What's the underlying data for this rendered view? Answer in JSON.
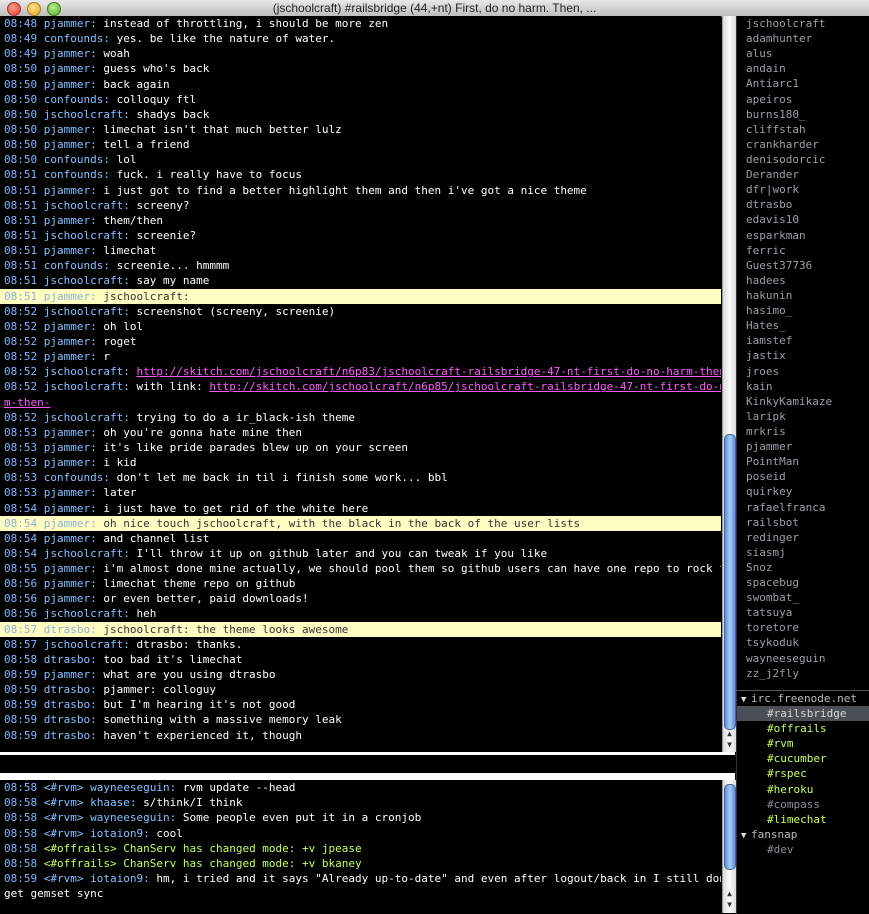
{
  "window": {
    "title": "(jschoolcraft) #railsbridge (44,+nt) First, do no harm. Then, ..."
  },
  "chat": [
    {
      "ts": "08:48",
      "nick": "pjammer:",
      "text": " instead of throttling, i should be more zen"
    },
    {
      "ts": "08:49",
      "nick": "confounds:",
      "text": " yes. be like the nature of water."
    },
    {
      "ts": "08:49",
      "nick": "pjammer:",
      "text": " woah"
    },
    {
      "ts": "08:50",
      "nick": "pjammer:",
      "text": " guess who's back"
    },
    {
      "ts": "08:50",
      "nick": "pjammer:",
      "text": " back again"
    },
    {
      "ts": "08:50",
      "nick": "confounds:",
      "text": " colloquy ftl"
    },
    {
      "ts": "08:50",
      "nick": "jschoolcraft:",
      "text": " shadys back"
    },
    {
      "ts": "08:50",
      "nick": "pjammer:",
      "text": " limechat isn't that much better lulz"
    },
    {
      "ts": "08:50",
      "nick": "pjammer:",
      "text": " tell a friend"
    },
    {
      "ts": "08:50",
      "nick": "confounds:",
      "text": " lol"
    },
    {
      "ts": "08:51",
      "nick": "confounds:",
      "text": " fuck. i really have to focus"
    },
    {
      "ts": "08:51",
      "nick": "pjammer:",
      "text": " i just got to find a better highlight them and then i've got a nice theme"
    },
    {
      "ts": "08:51",
      "nick": "jschoolcraft:",
      "text": " screeny?"
    },
    {
      "ts": "08:51",
      "nick": "pjammer:",
      "text": " them/then"
    },
    {
      "ts": "08:51",
      "nick": "jschoolcraft:",
      "text": " screenie?"
    },
    {
      "ts": "08:51",
      "nick": "pjammer:",
      "text": " limechat"
    },
    {
      "ts": "08:51",
      "nick": "confounds:",
      "text": " screenie... hmmmm"
    },
    {
      "ts": "08:51",
      "nick": "jschoolcraft:",
      "text": " say my name"
    },
    {
      "ts": "08:51",
      "nick": "pjammer:",
      "text": " jschoolcraft:",
      "hl": true
    },
    {
      "ts": "08:52",
      "nick": "jschoolcraft:",
      "text": " screenshot (screeny, screenie)"
    },
    {
      "ts": "08:52",
      "nick": "pjammer:",
      "text": " oh lol"
    },
    {
      "ts": "08:52",
      "nick": "pjammer:",
      "text": " roget"
    },
    {
      "ts": "08:52",
      "nick": "pjammer:",
      "text": " r"
    },
    {
      "ts": "08:52",
      "nick": "jschoolcraft:",
      "text": " ",
      "url": "http://skitch.com/jschoolcraft/n6p83/jschoolcraft-railsbridge-47-nt-first-do-no-harm-then-"
    },
    {
      "ts": "08:52",
      "nick": "jschoolcraft:",
      "text": " with link: ",
      "url": "http://skitch.com/jschoolcraft/n6p85/jschoolcraft-railsbridge-47-nt-first-do-no-har"
    },
    {
      "ts": "",
      "nick": "",
      "text": "",
      "url": "m-then-"
    },
    {
      "ts": "08:52",
      "nick": "jschoolcraft:",
      "text": " trying to do a ir_black-ish theme"
    },
    {
      "ts": "08:53",
      "nick": "pjammer:",
      "text": " oh you're gonna hate mine then"
    },
    {
      "ts": "08:53",
      "nick": "pjammer:",
      "text": " it's like pride parades blew up on your screen"
    },
    {
      "ts": "08:53",
      "nick": "pjammer:",
      "text": " i kid"
    },
    {
      "ts": "08:53",
      "nick": "confounds:",
      "text": " don't let me back in til i finish some work... bbl"
    },
    {
      "ts": "08:53",
      "nick": "pjammer:",
      "text": " later"
    },
    {
      "ts": "08:54",
      "nick": "pjammer:",
      "text": " i just have to get rid of the white here"
    },
    {
      "ts": "08:54",
      "nick": "pjammer:",
      "text": " oh nice touch jschoolcraft, with the black in the back of the user lists",
      "hl": true
    },
    {
      "ts": "08:54",
      "nick": "pjammer:",
      "text": " and channel list"
    },
    {
      "ts": "08:54",
      "nick": "jschoolcraft:",
      "text": " I'll throw it up on github later and you can tweak if you like"
    },
    {
      "ts": "08:55",
      "nick": "pjammer:",
      "text": " i'm almost done mine actually, we should pool them so github users can have one repo to rock from"
    },
    {
      "ts": "08:56",
      "nick": "pjammer:",
      "text": " limechat theme repo on github"
    },
    {
      "ts": "08:56",
      "nick": "pjammer:",
      "text": " or even better, paid downloads!"
    },
    {
      "ts": "08:56",
      "nick": "jschoolcraft:",
      "text": " heh"
    },
    {
      "ts": "08:57",
      "nick": "dtrasbo:",
      "text": " jschoolcraft: the theme looks awesome",
      "hl": true
    },
    {
      "ts": "08:57",
      "nick": "jschoolcraft:",
      "text": " dtrasbo: thanks."
    },
    {
      "ts": "08:58",
      "nick": "dtrasbo:",
      "text": " too bad it's limechat"
    },
    {
      "ts": "08:59",
      "nick": "pjammer:",
      "text": " what are you using dtrasbo"
    },
    {
      "ts": "08:59",
      "nick": "dtrasbo:",
      "text": " pjammer: colloguy"
    },
    {
      "ts": "08:59",
      "nick": "dtrasbo:",
      "text": " but I'm hearing it's not good"
    },
    {
      "ts": "08:59",
      "nick": "dtrasbo:",
      "text": " something with a massive memory leak"
    },
    {
      "ts": "08:59",
      "nick": "dtrasbo:",
      "text": " haven't experienced it, though"
    }
  ],
  "console": [
    {
      "ts": "08:58",
      "ch": "<#rvm>",
      "nick": "wayneeseguin:",
      "text": " rvm update --head"
    },
    {
      "ts": "08:58",
      "ch": "<#rvm>",
      "nick": "khaase:",
      "text": " s/think/I think"
    },
    {
      "ts": "08:58",
      "ch": "<#rvm>",
      "nick": "wayneeseguin:",
      "text": " Some people even put it in a cronjob"
    },
    {
      "ts": "08:58",
      "ch": "<#rvm>",
      "nick": "iotaion9:",
      "text": " cool"
    },
    {
      "ts": "08:58",
      "ch": "<#offrails>",
      "nick": "",
      "text": " ChanServ has changed mode: +v jpease",
      "mode": true
    },
    {
      "ts": "08:58",
      "ch": "<#offrails>",
      "nick": "",
      "text": " ChanServ has changed mode: +v bkaney",
      "mode": true
    },
    {
      "ts": "08:59",
      "ch": "<#rvm>",
      "nick": "iotaion9:",
      "text": " hm, i tried and it says \"Already up-to-date\" and even after logout/back in I still don't"
    },
    {
      "ts": "",
      "ch": "",
      "nick": "",
      "text": "get gemset sync"
    }
  ],
  "users": [
    "jschoolcraft",
    "adamhunter",
    "alus",
    "andain",
    "Antiarc1",
    "apeiros",
    "burns180_",
    "cliffstah",
    "crankharder",
    "denisodorcic",
    "Derander",
    "dfr|work",
    "dtrasbo",
    "edavis10",
    "esparkman",
    "ferric",
    "Guest37736",
    "hadees",
    "hakunin",
    "hasimo_",
    "Hates_",
    "iamstef",
    "jastix",
    "jroes",
    "kain",
    "KinkyKamikaze",
    "laripk",
    "mrkris",
    "pjammer",
    "PointMan",
    "poseid",
    "quirkey",
    "rafaelfranca",
    "railsbot",
    "redinger",
    "siasmj",
    "Snoz",
    "spacebug",
    "swombat_",
    "tatsuya",
    "toretore",
    "tsykoduk",
    "wayneeseguin",
    "zz_j2fly"
  ],
  "servers": [
    {
      "name": "irc.freenode.net",
      "tri": "▼",
      "channels": [
        {
          "name": "#railsbridge",
          "state": "sel"
        },
        {
          "name": "#offrails",
          "state": "active"
        },
        {
          "name": "#rvm",
          "state": "active"
        },
        {
          "name": "#cucumber",
          "state": "active"
        },
        {
          "name": "#rspec",
          "state": "active"
        },
        {
          "name": "#heroku",
          "state": "active"
        },
        {
          "name": "#compass",
          "state": "dim"
        },
        {
          "name": "#limechat",
          "state": "active"
        }
      ]
    },
    {
      "name": "fansnap",
      "tri": "▼",
      "channels": [
        {
          "name": "#dev",
          "state": "dim"
        }
      ]
    }
  ],
  "scrollbars": {
    "chat_arrow_up": "▲",
    "chat_arrow_down": "▼",
    "console_arrow_up": "▲",
    "console_arrow_down": "▼"
  }
}
